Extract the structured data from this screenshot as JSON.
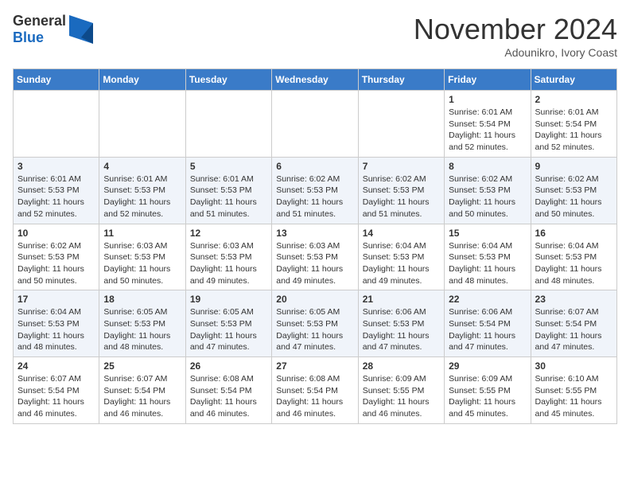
{
  "header": {
    "logo_line1": "General",
    "logo_line2": "Blue",
    "month": "November 2024",
    "location": "Adounikro, Ivory Coast"
  },
  "weekdays": [
    "Sunday",
    "Monday",
    "Tuesday",
    "Wednesday",
    "Thursday",
    "Friday",
    "Saturday"
  ],
  "weeks": [
    [
      null,
      null,
      null,
      null,
      null,
      {
        "day": 1,
        "sunrise": "6:01 AM",
        "sunset": "5:54 PM",
        "daylight": "11 hours and 52 minutes."
      },
      {
        "day": 2,
        "sunrise": "6:01 AM",
        "sunset": "5:54 PM",
        "daylight": "11 hours and 52 minutes."
      }
    ],
    [
      {
        "day": 3,
        "sunrise": "6:01 AM",
        "sunset": "5:53 PM",
        "daylight": "11 hours and 52 minutes."
      },
      {
        "day": 4,
        "sunrise": "6:01 AM",
        "sunset": "5:53 PM",
        "daylight": "11 hours and 52 minutes."
      },
      {
        "day": 5,
        "sunrise": "6:01 AM",
        "sunset": "5:53 PM",
        "daylight": "11 hours and 51 minutes."
      },
      {
        "day": 6,
        "sunrise": "6:02 AM",
        "sunset": "5:53 PM",
        "daylight": "11 hours and 51 minutes."
      },
      {
        "day": 7,
        "sunrise": "6:02 AM",
        "sunset": "5:53 PM",
        "daylight": "11 hours and 51 minutes."
      },
      {
        "day": 8,
        "sunrise": "6:02 AM",
        "sunset": "5:53 PM",
        "daylight": "11 hours and 50 minutes."
      },
      {
        "day": 9,
        "sunrise": "6:02 AM",
        "sunset": "5:53 PM",
        "daylight": "11 hours and 50 minutes."
      }
    ],
    [
      {
        "day": 10,
        "sunrise": "6:02 AM",
        "sunset": "5:53 PM",
        "daylight": "11 hours and 50 minutes."
      },
      {
        "day": 11,
        "sunrise": "6:03 AM",
        "sunset": "5:53 PM",
        "daylight": "11 hours and 50 minutes."
      },
      {
        "day": 12,
        "sunrise": "6:03 AM",
        "sunset": "5:53 PM",
        "daylight": "11 hours and 49 minutes."
      },
      {
        "day": 13,
        "sunrise": "6:03 AM",
        "sunset": "5:53 PM",
        "daylight": "11 hours and 49 minutes."
      },
      {
        "day": 14,
        "sunrise": "6:04 AM",
        "sunset": "5:53 PM",
        "daylight": "11 hours and 49 minutes."
      },
      {
        "day": 15,
        "sunrise": "6:04 AM",
        "sunset": "5:53 PM",
        "daylight": "11 hours and 48 minutes."
      },
      {
        "day": 16,
        "sunrise": "6:04 AM",
        "sunset": "5:53 PM",
        "daylight": "11 hours and 48 minutes."
      }
    ],
    [
      {
        "day": 17,
        "sunrise": "6:04 AM",
        "sunset": "5:53 PM",
        "daylight": "11 hours and 48 minutes."
      },
      {
        "day": 18,
        "sunrise": "6:05 AM",
        "sunset": "5:53 PM",
        "daylight": "11 hours and 48 minutes."
      },
      {
        "day": 19,
        "sunrise": "6:05 AM",
        "sunset": "5:53 PM",
        "daylight": "11 hours and 47 minutes."
      },
      {
        "day": 20,
        "sunrise": "6:05 AM",
        "sunset": "5:53 PM",
        "daylight": "11 hours and 47 minutes."
      },
      {
        "day": 21,
        "sunrise": "6:06 AM",
        "sunset": "5:53 PM",
        "daylight": "11 hours and 47 minutes."
      },
      {
        "day": 22,
        "sunrise": "6:06 AM",
        "sunset": "5:54 PM",
        "daylight": "11 hours and 47 minutes."
      },
      {
        "day": 23,
        "sunrise": "6:07 AM",
        "sunset": "5:54 PM",
        "daylight": "11 hours and 47 minutes."
      }
    ],
    [
      {
        "day": 24,
        "sunrise": "6:07 AM",
        "sunset": "5:54 PM",
        "daylight": "11 hours and 46 minutes."
      },
      {
        "day": 25,
        "sunrise": "6:07 AM",
        "sunset": "5:54 PM",
        "daylight": "11 hours and 46 minutes."
      },
      {
        "day": 26,
        "sunrise": "6:08 AM",
        "sunset": "5:54 PM",
        "daylight": "11 hours and 46 minutes."
      },
      {
        "day": 27,
        "sunrise": "6:08 AM",
        "sunset": "5:54 PM",
        "daylight": "11 hours and 46 minutes."
      },
      {
        "day": 28,
        "sunrise": "6:09 AM",
        "sunset": "5:55 PM",
        "daylight": "11 hours and 46 minutes."
      },
      {
        "day": 29,
        "sunrise": "6:09 AM",
        "sunset": "5:55 PM",
        "daylight": "11 hours and 45 minutes."
      },
      {
        "day": 30,
        "sunrise": "6:10 AM",
        "sunset": "5:55 PM",
        "daylight": "11 hours and 45 minutes."
      }
    ]
  ]
}
